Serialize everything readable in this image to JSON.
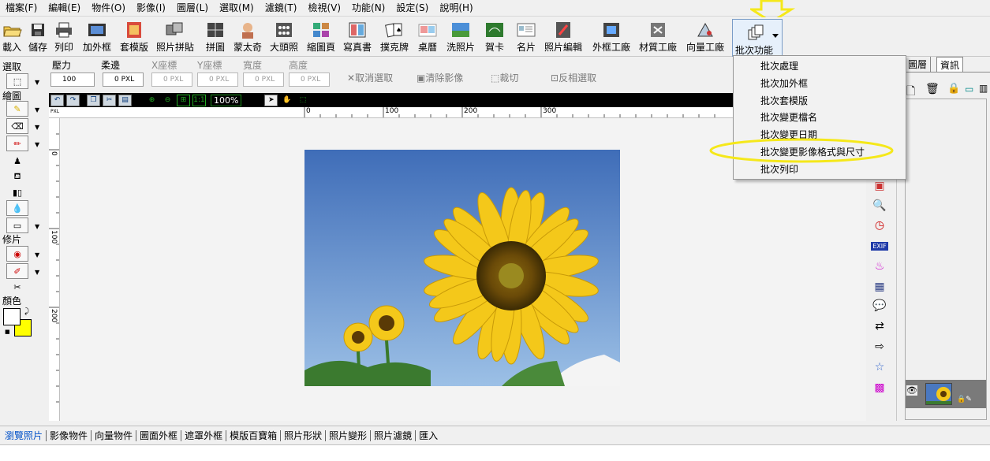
{
  "menu": [
    "檔案(F)",
    "編輯(E)",
    "物件(O)",
    "影像(I)",
    "圖層(L)",
    "選取(M)",
    "濾鏡(T)",
    "檢視(V)",
    "功能(N)",
    "設定(S)",
    "說明(H)"
  ],
  "toolbar": {
    "buttons": [
      {
        "label": "載入",
        "icon": "open-folder-icon"
      },
      {
        "label": "儲存",
        "icon": "save-icon"
      },
      {
        "label": "列印",
        "icon": "print-icon"
      },
      {
        "label": "加外框",
        "icon": "frame-icon"
      },
      {
        "label": "套模版",
        "icon": "template-icon"
      },
      {
        "label": "照片拼貼",
        "icon": "collage-icon"
      },
      {
        "label": "拼圖",
        "icon": "puzzle-icon"
      },
      {
        "label": "蒙太奇",
        "icon": "montage-icon"
      },
      {
        "label": "大頭照",
        "icon": "id-photo-icon"
      },
      {
        "label": "縮圖頁",
        "icon": "thumbnail-page-icon"
      },
      {
        "label": "寫真書",
        "icon": "photo-book-icon"
      },
      {
        "label": "撲克牌",
        "icon": "poker-icon"
      },
      {
        "label": "桌曆",
        "icon": "calendar-icon"
      },
      {
        "label": "洗照片",
        "icon": "print-photo-icon"
      },
      {
        "label": "賀卡",
        "icon": "greeting-card-icon"
      },
      {
        "label": "名片",
        "icon": "business-card-icon"
      },
      {
        "label": "照片編輯",
        "icon": "photo-edit-icon"
      },
      {
        "label": "外框工廠",
        "icon": "frame-factory-icon"
      },
      {
        "label": "材質工廠",
        "icon": "texture-factory-icon"
      },
      {
        "label": "向量工廠",
        "icon": "vector-factory-icon"
      },
      {
        "label": "批次功能",
        "icon": "batch-icon"
      }
    ]
  },
  "options": {
    "pressure_label": "壓力",
    "pressure_value": "100",
    "feather_label": "柔邊",
    "feather_value": "0",
    "x_label": "X座標",
    "x_value": "0",
    "y_label": "Y座標",
    "y_value": "0",
    "w_label": "寬度",
    "w_value": "0",
    "h_label": "高度",
    "h_value": "0",
    "unit": "PXL",
    "cancel_select": "取消選取",
    "clear_image": "清除影像",
    "crop": "裁切",
    "invert_select": "反相選取"
  },
  "left": {
    "select": "選取",
    "draw": "繪圖",
    "retouch": "修片",
    "color": "顏色"
  },
  "canvas": {
    "zoom": "100%",
    "unit": "PXL",
    "hticks": [
      "0",
      "100",
      "200",
      "300"
    ],
    "vticks": [
      "0",
      "100",
      "200"
    ]
  },
  "right_panel": {
    "tabs": [
      "圖層",
      "資訊"
    ],
    "exif": "EXIF"
  },
  "batch_menu": {
    "items": [
      "批次處理",
      "批次加外框",
      "批次套模版",
      "批次變更檔名",
      "批次變更日期",
      "批次變更影像格式與尺寸",
      "批次列印"
    ]
  },
  "bottom_tabs": [
    "瀏覽照片",
    "影像物件",
    "向量物件",
    "圖面外框",
    "遮罩外框",
    "模版百寶箱",
    "照片形狀",
    "照片變形",
    "照片濾鏡",
    "匯入"
  ],
  "colors": {
    "foreground": "#ffffff",
    "background": "#ffff00",
    "highlight": "#ffff00"
  }
}
